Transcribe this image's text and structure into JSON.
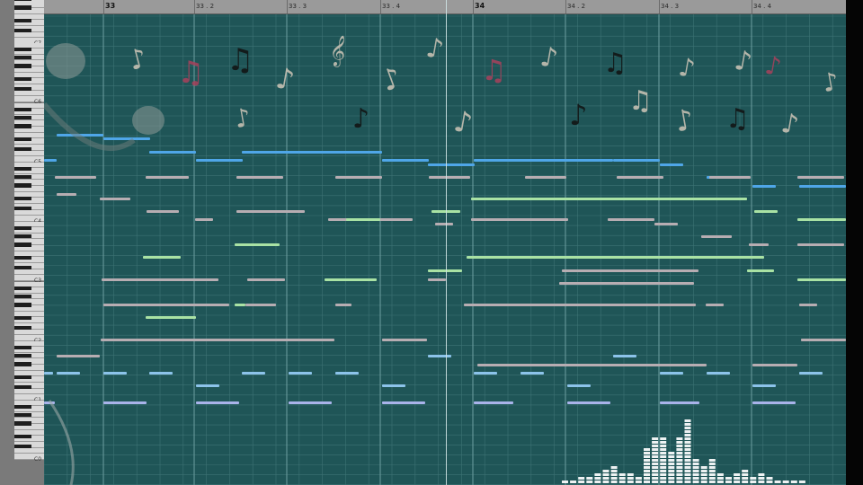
{
  "ruler": {
    "labels": [
      {
        "text": "33",
        "bar": true
      },
      {
        "text": "33 . 2",
        "bar": false
      },
      {
        "text": "33 . 3",
        "bar": false
      },
      {
        "text": "33 . 4",
        "bar": false
      },
      {
        "text": "34",
        "bar": true
      },
      {
        "text": "34 . 2",
        "bar": false
      },
      {
        "text": "34 . 3",
        "bar": false
      },
      {
        "text": "34 . 4",
        "bar": false
      }
    ]
  },
  "keyboard": {
    "octaves": [
      "C7",
      "C6",
      "C5",
      "C4",
      "C3",
      "C2",
      "C1",
      "C0"
    ]
  },
  "colors": {
    "background": "#1f5557",
    "grid_line": "#3e7375",
    "grid_line_bar": "#6e9ea0",
    "note_blue": "#4fa6e8",
    "note_gray": "#b7adb2",
    "note_green": "#a9e2a4",
    "note_lightblue": "#8cc3ea",
    "note_periwinkle": "#a9b3ea",
    "playhead": "#cfe3e4"
  },
  "decor": {
    "icon": "music-note-icon",
    "spectrum_icon": "spectrum-bars-icon"
  }
}
